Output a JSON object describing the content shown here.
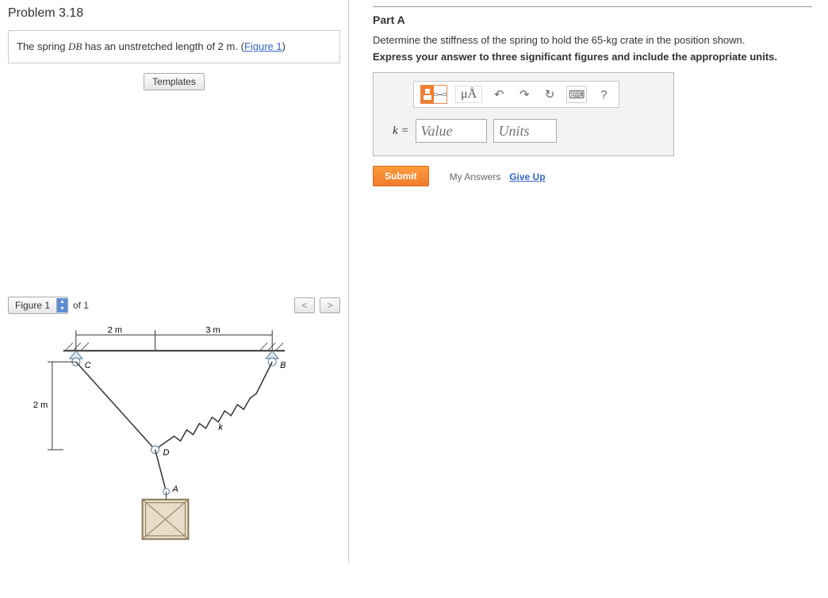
{
  "problem": {
    "title": "Problem 3.18",
    "statement_pre": "The spring ",
    "statement_var": "DB",
    "statement_mid": " has an unstretched length of 2 ",
    "statement_unit": "m",
    "statement_post": ". (",
    "figure_link": "Figure 1",
    "statement_close": ")"
  },
  "templates_btn": "Templates",
  "figure": {
    "label": "Figure 1",
    "of": "of 1",
    "prev": "<",
    "next": ">",
    "dims": {
      "d1": "2 m",
      "d2": "3 m",
      "d3": "2 m"
    },
    "points": {
      "C": "C",
      "B": "B",
      "D": "D",
      "A": "A",
      "k": "k"
    }
  },
  "partA": {
    "heading": "Part A",
    "question": "Determine the stiffness of the spring to hold the 65-kg crate in the position shown.",
    "instruction": "Express your answer to three significant figures and include the appropriate units.",
    "variable": "k =",
    "value_placeholder": "Value",
    "units_placeholder": "Units",
    "toolbar": {
      "units_btn": "μÅ",
      "help": "?"
    },
    "submit": "Submit",
    "my_answers": "My Answers",
    "give_up": "Give Up"
  }
}
